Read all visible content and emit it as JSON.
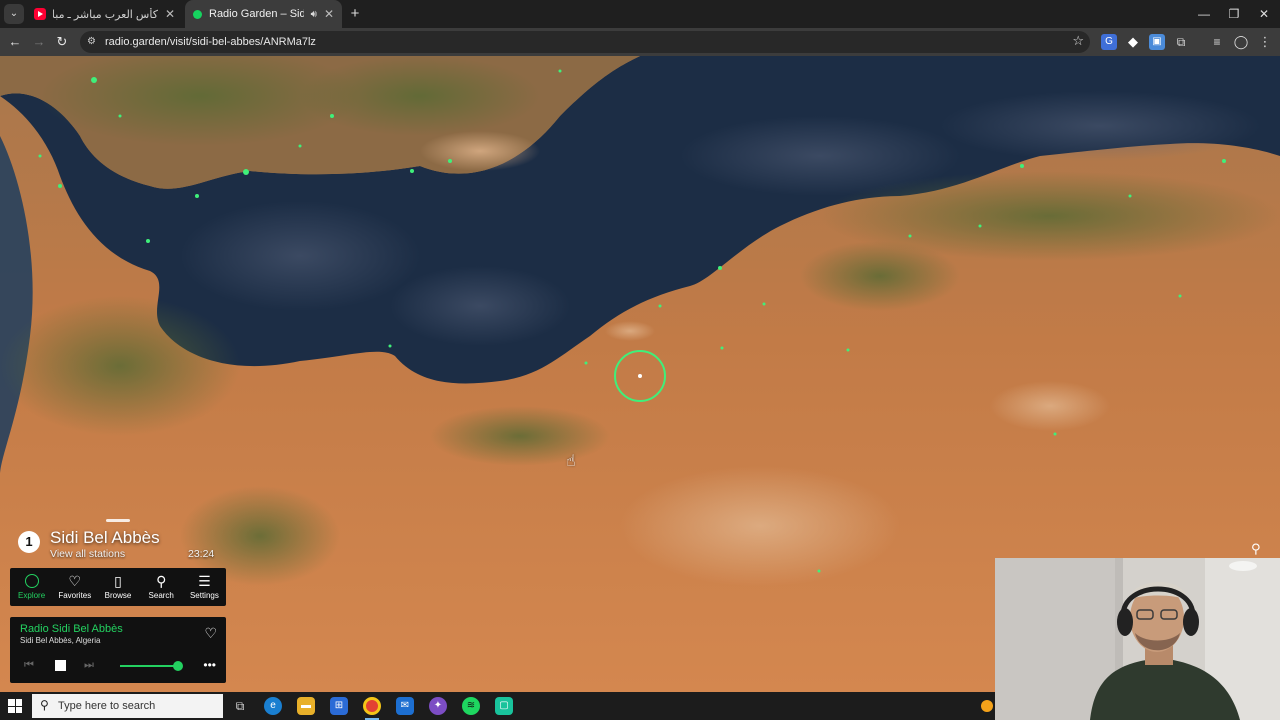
{
  "browser": {
    "tabs": [
      {
        "title": "كأس العرب مباشر ـ مباراة : الأردن",
        "favicon": "youtube-icon",
        "active": false
      },
      {
        "title": "Radio Garden – Sidi Bel Abb",
        "favicon": "radio-garden-icon",
        "active": true
      }
    ],
    "url": "radio.garden/visit/sidi-bel-abbes/ANRMa7lz"
  },
  "location": {
    "count": "1",
    "name": "Sidi Bel Abbès",
    "link": "View all stations",
    "time": "23:24"
  },
  "nav": [
    {
      "label": "Explore",
      "icon": "explore-icon",
      "active": true
    },
    {
      "label": "Favorites",
      "icon": "heart-icon",
      "active": false
    },
    {
      "label": "Browse",
      "icon": "map-icon",
      "active": false
    },
    {
      "label": "Search",
      "icon": "search-icon",
      "active": false
    },
    {
      "label": "Settings",
      "icon": "menu-icon",
      "active": false
    }
  ],
  "player": {
    "station": "Radio Sidi Bel Abbès",
    "place": "Sidi Bel Abbès, Algeria",
    "volume": 1.0
  },
  "taskbar": {
    "search_placeholder": "Type here to search"
  },
  "colors": {
    "accent": "#23d160",
    "sea": "#1c2d45",
    "land": "#c97a45"
  }
}
